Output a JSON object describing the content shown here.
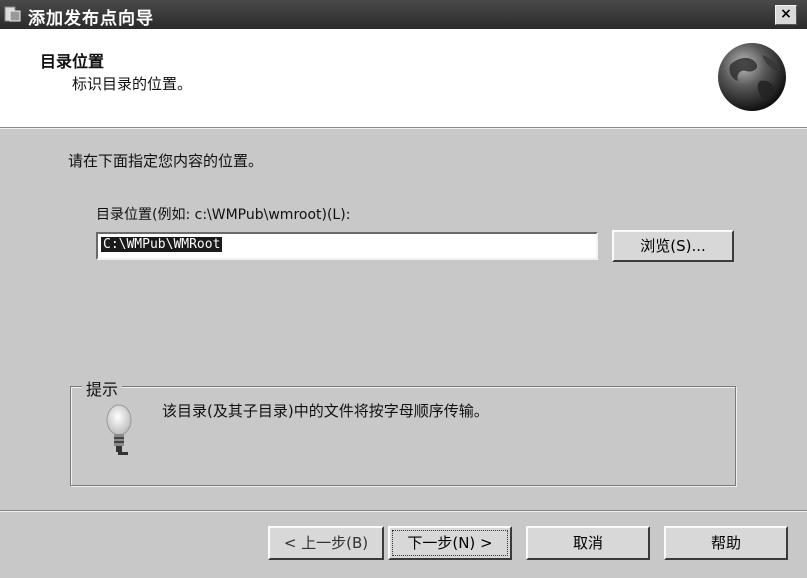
{
  "window": {
    "title": "添加发布点向导",
    "close_glyph": "×",
    "app_icon": "wizard-icon"
  },
  "header": {
    "title": "目录位置",
    "subtitle": "标识目录的位置。",
    "icon": "globe-icon"
  },
  "body": {
    "instruction": "请在下面指定您内容的位置。",
    "field_label": "目录位置(例如: c:\\WMPub\\wmroot)(L):",
    "path_value": "C:\\WMPub\\WMRoot",
    "browse_label": "浏览(S)..."
  },
  "tips": {
    "legend": "提示",
    "icon": "lightbulb-icon",
    "text": "该目录(及其子目录)中的文件将按字母顺序传输。"
  },
  "buttons": {
    "back": "< 上一步(B)",
    "next": "下一步(N) >",
    "cancel": "取消",
    "help": "帮助"
  }
}
